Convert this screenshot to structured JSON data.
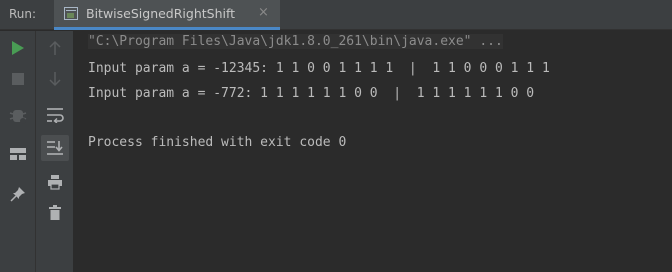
{
  "run_panel": {
    "label": "Run:",
    "tab_title": "BitwiseSignedRightShift",
    "tab_close": "×"
  },
  "toolbar_left": {
    "icons": [
      "run-icon",
      "stop-icon",
      "debug-icon",
      "layout-icon",
      "pin-icon"
    ]
  },
  "toolbar_right": {
    "icons": [
      "arrow-up-icon",
      "arrow-down-icon",
      "soft-wrap-icon",
      "scroll-to-end-icon",
      "print-icon",
      "trash-icon"
    ]
  },
  "console": {
    "lines": [
      "\"C:\\Program Files\\Java\\jdk1.8.0_261\\bin\\java.exe\" ...",
      "Input param a = -12345: 1 1 0 0 1 1 1 1  |  1 1 0 0 0 1 1 1",
      "Input param a = -772: 1 1 1 1 1 1 0 0  |  1 1 1 1 1 1 0 0",
      "",
      "Process finished with exit code 0"
    ]
  },
  "colors": {
    "accent": "#4a88c7",
    "run_green": "#499c54",
    "console_text": "#bbbbbb"
  }
}
